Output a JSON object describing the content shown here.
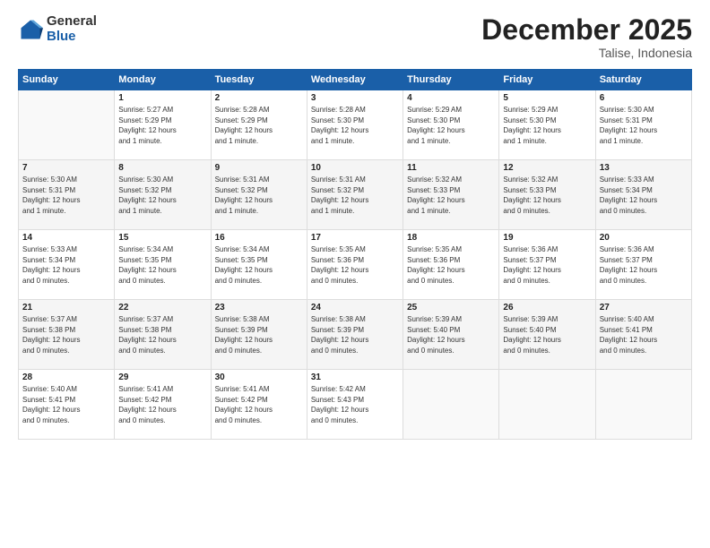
{
  "logo": {
    "general": "General",
    "blue": "Blue"
  },
  "title": "December 2025",
  "subtitle": "Talise, Indonesia",
  "days_header": [
    "Sunday",
    "Monday",
    "Tuesday",
    "Wednesday",
    "Thursday",
    "Friday",
    "Saturday"
  ],
  "weeks": [
    [
      {
        "num": "",
        "info": ""
      },
      {
        "num": "1",
        "info": "Sunrise: 5:27 AM\nSunset: 5:29 PM\nDaylight: 12 hours\nand 1 minute."
      },
      {
        "num": "2",
        "info": "Sunrise: 5:28 AM\nSunset: 5:29 PM\nDaylight: 12 hours\nand 1 minute."
      },
      {
        "num": "3",
        "info": "Sunrise: 5:28 AM\nSunset: 5:30 PM\nDaylight: 12 hours\nand 1 minute."
      },
      {
        "num": "4",
        "info": "Sunrise: 5:29 AM\nSunset: 5:30 PM\nDaylight: 12 hours\nand 1 minute."
      },
      {
        "num": "5",
        "info": "Sunrise: 5:29 AM\nSunset: 5:30 PM\nDaylight: 12 hours\nand 1 minute."
      },
      {
        "num": "6",
        "info": "Sunrise: 5:30 AM\nSunset: 5:31 PM\nDaylight: 12 hours\nand 1 minute."
      }
    ],
    [
      {
        "num": "7",
        "info": "Sunrise: 5:30 AM\nSunset: 5:31 PM\nDaylight: 12 hours\nand 1 minute."
      },
      {
        "num": "8",
        "info": "Sunrise: 5:30 AM\nSunset: 5:32 PM\nDaylight: 12 hours\nand 1 minute."
      },
      {
        "num": "9",
        "info": "Sunrise: 5:31 AM\nSunset: 5:32 PM\nDaylight: 12 hours\nand 1 minute."
      },
      {
        "num": "10",
        "info": "Sunrise: 5:31 AM\nSunset: 5:32 PM\nDaylight: 12 hours\nand 1 minute."
      },
      {
        "num": "11",
        "info": "Sunrise: 5:32 AM\nSunset: 5:33 PM\nDaylight: 12 hours\nand 1 minute."
      },
      {
        "num": "12",
        "info": "Sunrise: 5:32 AM\nSunset: 5:33 PM\nDaylight: 12 hours\nand 0 minutes."
      },
      {
        "num": "13",
        "info": "Sunrise: 5:33 AM\nSunset: 5:34 PM\nDaylight: 12 hours\nand 0 minutes."
      }
    ],
    [
      {
        "num": "14",
        "info": "Sunrise: 5:33 AM\nSunset: 5:34 PM\nDaylight: 12 hours\nand 0 minutes."
      },
      {
        "num": "15",
        "info": "Sunrise: 5:34 AM\nSunset: 5:35 PM\nDaylight: 12 hours\nand 0 minutes."
      },
      {
        "num": "16",
        "info": "Sunrise: 5:34 AM\nSunset: 5:35 PM\nDaylight: 12 hours\nand 0 minutes."
      },
      {
        "num": "17",
        "info": "Sunrise: 5:35 AM\nSunset: 5:36 PM\nDaylight: 12 hours\nand 0 minutes."
      },
      {
        "num": "18",
        "info": "Sunrise: 5:35 AM\nSunset: 5:36 PM\nDaylight: 12 hours\nand 0 minutes."
      },
      {
        "num": "19",
        "info": "Sunrise: 5:36 AM\nSunset: 5:37 PM\nDaylight: 12 hours\nand 0 minutes."
      },
      {
        "num": "20",
        "info": "Sunrise: 5:36 AM\nSunset: 5:37 PM\nDaylight: 12 hours\nand 0 minutes."
      }
    ],
    [
      {
        "num": "21",
        "info": "Sunrise: 5:37 AM\nSunset: 5:38 PM\nDaylight: 12 hours\nand 0 minutes."
      },
      {
        "num": "22",
        "info": "Sunrise: 5:37 AM\nSunset: 5:38 PM\nDaylight: 12 hours\nand 0 minutes."
      },
      {
        "num": "23",
        "info": "Sunrise: 5:38 AM\nSunset: 5:39 PM\nDaylight: 12 hours\nand 0 minutes."
      },
      {
        "num": "24",
        "info": "Sunrise: 5:38 AM\nSunset: 5:39 PM\nDaylight: 12 hours\nand 0 minutes."
      },
      {
        "num": "25",
        "info": "Sunrise: 5:39 AM\nSunset: 5:40 PM\nDaylight: 12 hours\nand 0 minutes."
      },
      {
        "num": "26",
        "info": "Sunrise: 5:39 AM\nSunset: 5:40 PM\nDaylight: 12 hours\nand 0 minutes."
      },
      {
        "num": "27",
        "info": "Sunrise: 5:40 AM\nSunset: 5:41 PM\nDaylight: 12 hours\nand 0 minutes."
      }
    ],
    [
      {
        "num": "28",
        "info": "Sunrise: 5:40 AM\nSunset: 5:41 PM\nDaylight: 12 hours\nand 0 minutes."
      },
      {
        "num": "29",
        "info": "Sunrise: 5:41 AM\nSunset: 5:42 PM\nDaylight: 12 hours\nand 0 minutes."
      },
      {
        "num": "30",
        "info": "Sunrise: 5:41 AM\nSunset: 5:42 PM\nDaylight: 12 hours\nand 0 minutes."
      },
      {
        "num": "31",
        "info": "Sunrise: 5:42 AM\nSunset: 5:43 PM\nDaylight: 12 hours\nand 0 minutes."
      },
      {
        "num": "",
        "info": ""
      },
      {
        "num": "",
        "info": ""
      },
      {
        "num": "",
        "info": ""
      }
    ]
  ]
}
